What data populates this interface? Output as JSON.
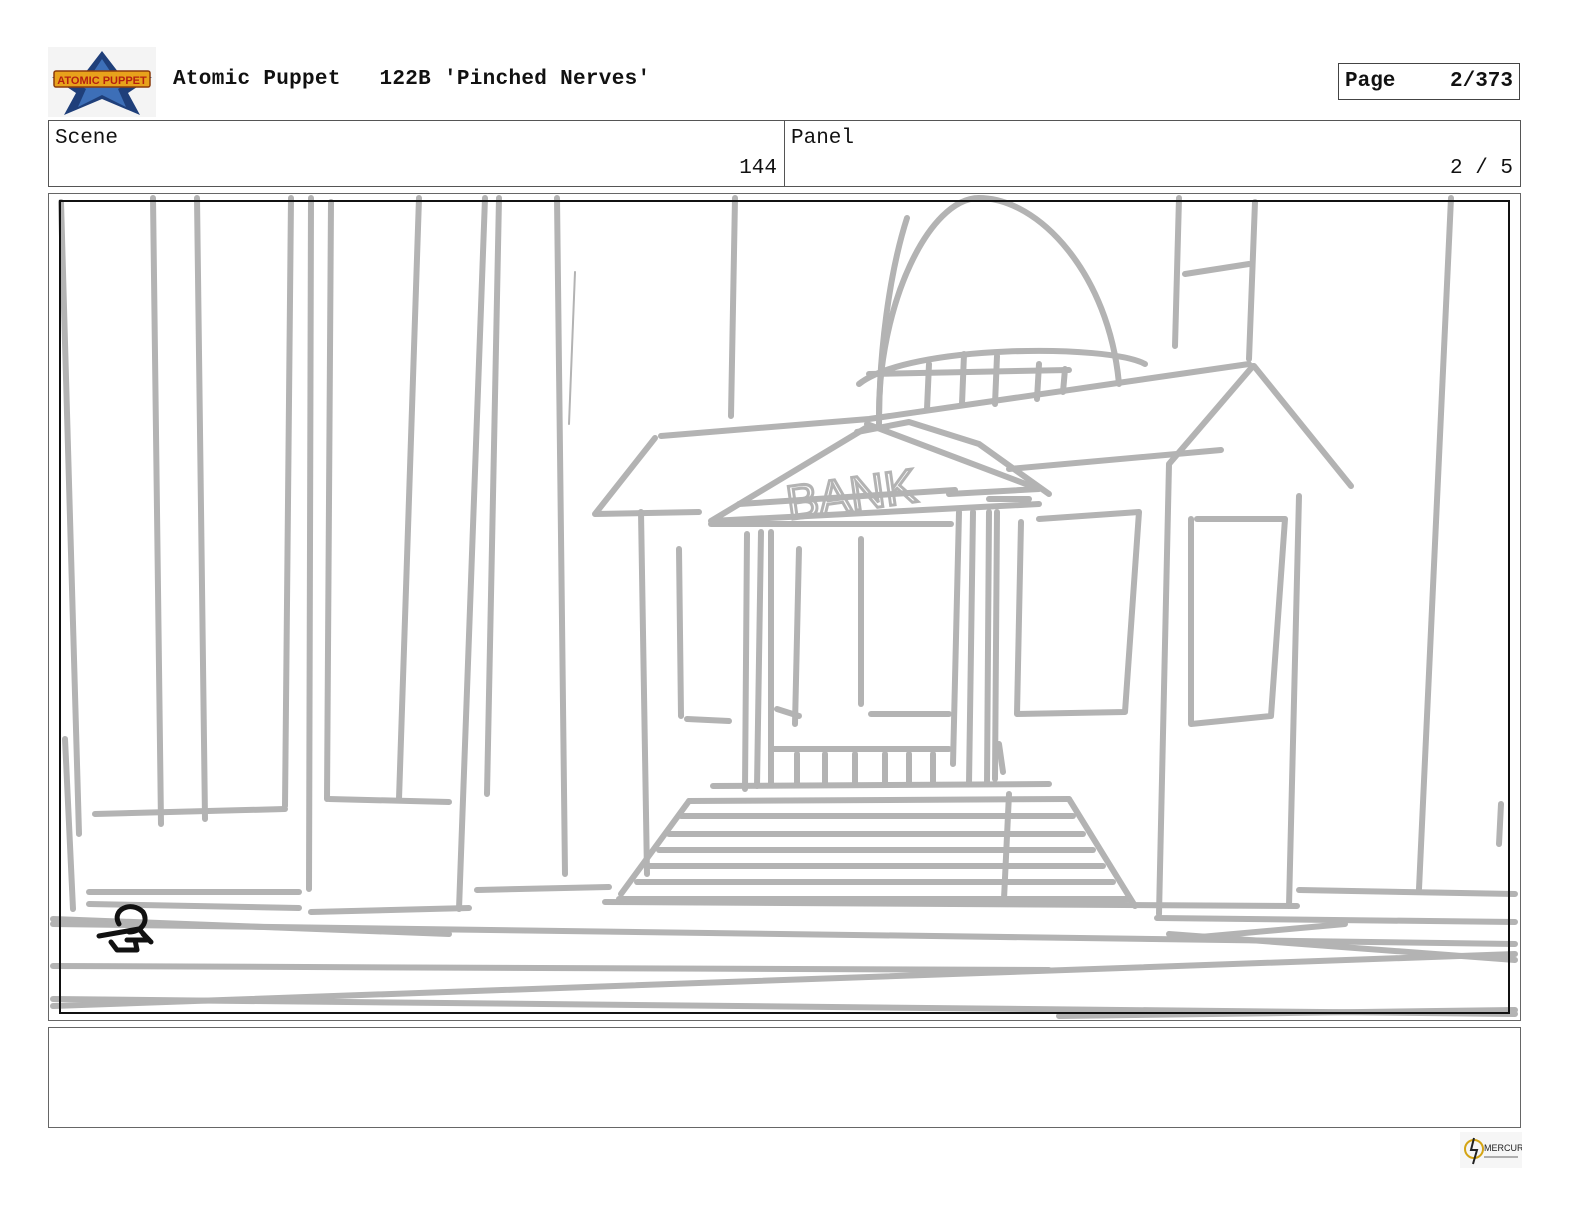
{
  "header": {
    "logo_text": "ATOMIC PUPPET",
    "show": "Atomic Puppet",
    "episode": "122B 'Pinched Nerves'",
    "page_label": "Page",
    "page_value": "2/373"
  },
  "info": {
    "scene_label": "Scene",
    "scene_value": "144",
    "panel_label": "Panel",
    "panel_value": "2 / 5"
  },
  "panel": {
    "sign_text": "BANK"
  },
  "caption": {
    "text": ""
  },
  "footer": {
    "studio_logo_text": "MERCURY"
  }
}
